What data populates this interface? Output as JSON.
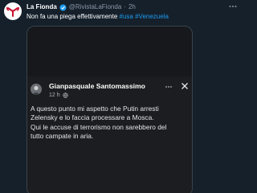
{
  "tweet": {
    "display_name": "La Fionda",
    "handle": "@RivistaLaFionda",
    "separator": "·",
    "time": "2h",
    "text_plain": "Non fa una piega effettivamente",
    "hashtags": [
      "#usa",
      "#Venezuela"
    ]
  },
  "embedded_post": {
    "author_name": "Gianpasquale Santomassimo",
    "time": "12 h",
    "text_lines": [
      "A questo punto mi aspetto che Putin arresti",
      "Zelensky e lo faccia processare a Mosca.",
      "Qui le accuse di terrorismo non sarebbero del",
      "tutto campate in aria."
    ]
  },
  "icons": {
    "avatar": "fionda-logo-icon",
    "verified": "verified-badge-icon",
    "more": "more-options-icon",
    "globe": "globe-icon",
    "close": "close-icon"
  },
  "colors": {
    "background": "#15202b",
    "accent": "#1d9bf0",
    "secondary_text": "#8b98a5",
    "logo_red": "#c8102e"
  }
}
